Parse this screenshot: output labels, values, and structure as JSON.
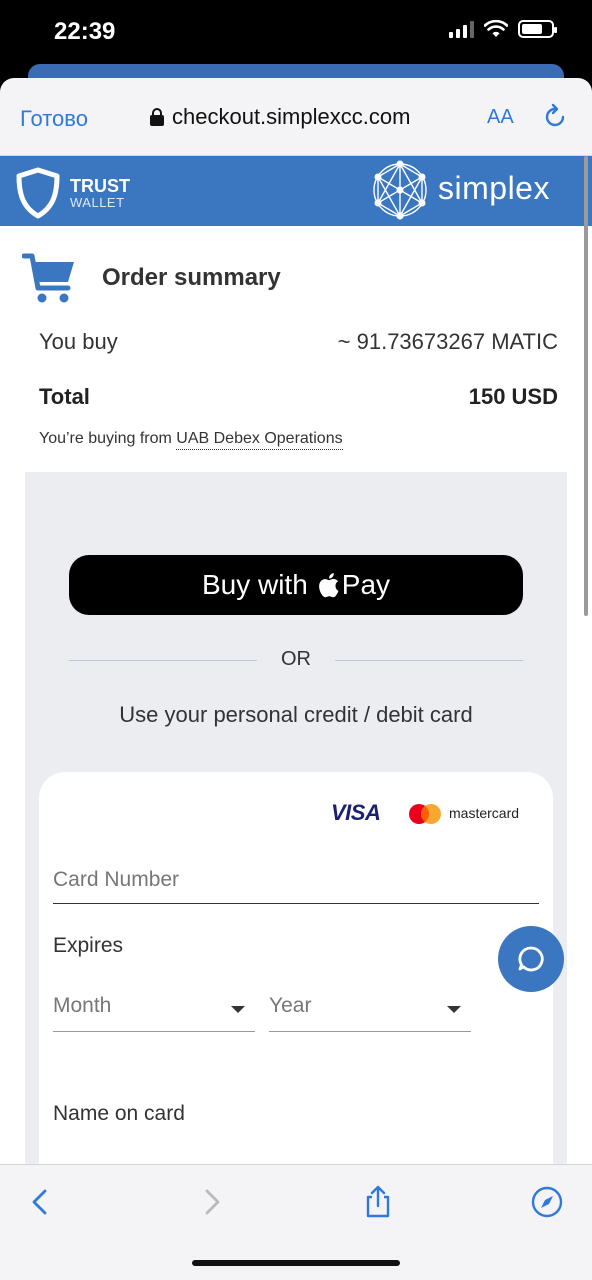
{
  "status_bar": {
    "time": "22:39"
  },
  "browser": {
    "done_label": "Готово",
    "url": "checkout.simplexcc.com",
    "text_size_label": "AA"
  },
  "brand": {
    "wallet_name_line1": "TRUST",
    "wallet_name_line2": "WALLET",
    "processor_name": "simplex",
    "accent_color": "#3a77c0"
  },
  "order": {
    "title": "Order summary",
    "you_buy_label": "You buy",
    "you_buy_value": "~ 91.73673267 MATIC",
    "total_label": "Total",
    "total_value": "150 USD",
    "buying_from_prefix": "You’re buying from",
    "seller": "UAB Debex Operations"
  },
  "payment": {
    "apple_pay_prefix": "Buy with",
    "apple_pay_suffix": "Pay",
    "or_label": "OR",
    "card_prompt": "Use your personal credit / debit card",
    "card_brands": [
      "VISA",
      "mastercard"
    ],
    "card_number_placeholder": "Card Number",
    "expires_label": "Expires",
    "month_placeholder": "Month",
    "year_placeholder": "Year",
    "name_label": "Name on card"
  },
  "toolbar": {
    "icons": [
      "back-icon",
      "forward-icon",
      "share-icon",
      "compass-icon"
    ]
  }
}
